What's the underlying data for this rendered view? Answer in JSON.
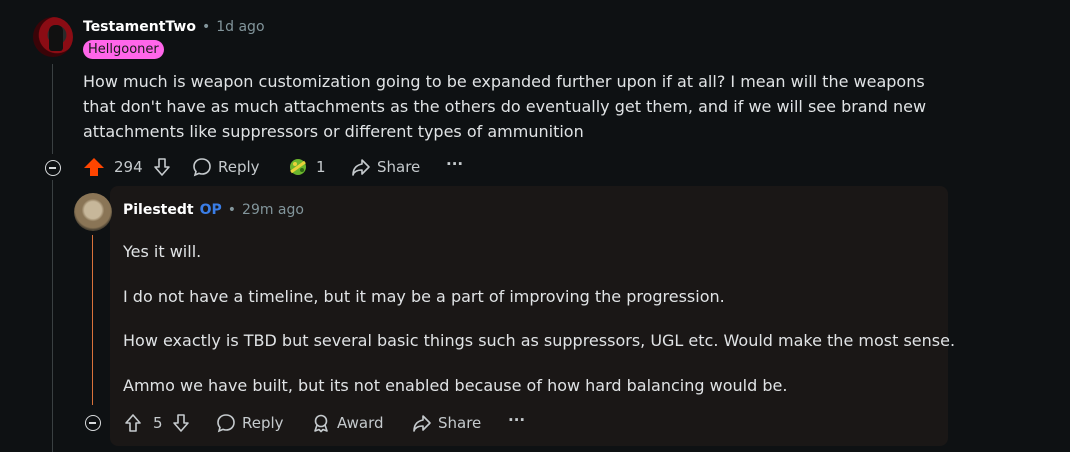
{
  "parent": {
    "author": "TestamentTwo",
    "separator": "•",
    "time": "1d ago",
    "flair": "Hellgooner",
    "body": "How much is weapon customization going to be expanded further upon if at all? I mean will the weapons that don't have as much attachments as the others do eventually get them, and if we will see brand new attachments like suppressors or different types of ammunition",
    "score": "294",
    "reply_label": "Reply",
    "award_count": "1",
    "share_label": "Share",
    "more_label": "···"
  },
  "reply": {
    "author": "Pilestedt",
    "op_badge": "OP",
    "separator": "•",
    "time": "29m ago",
    "paragraphs": [
      "Yes it will.",
      "I do not have a timeline, but it may be a part of improving the progression.",
      "How exactly is TBD but several basic things such as suppressors, UGL etc. Would make the most sense.",
      "Ammo we have built, but its not enabled because of how hard balancing would be."
    ],
    "score": "5",
    "reply_label": "Reply",
    "award_label": "Award",
    "share_label": "Share",
    "more_label": "···"
  },
  "colors": {
    "upvote_active": "#ff4500",
    "flair_bg": "#ff66ea",
    "op": "#3a7de6",
    "thread_highlight": "#d9723b"
  }
}
